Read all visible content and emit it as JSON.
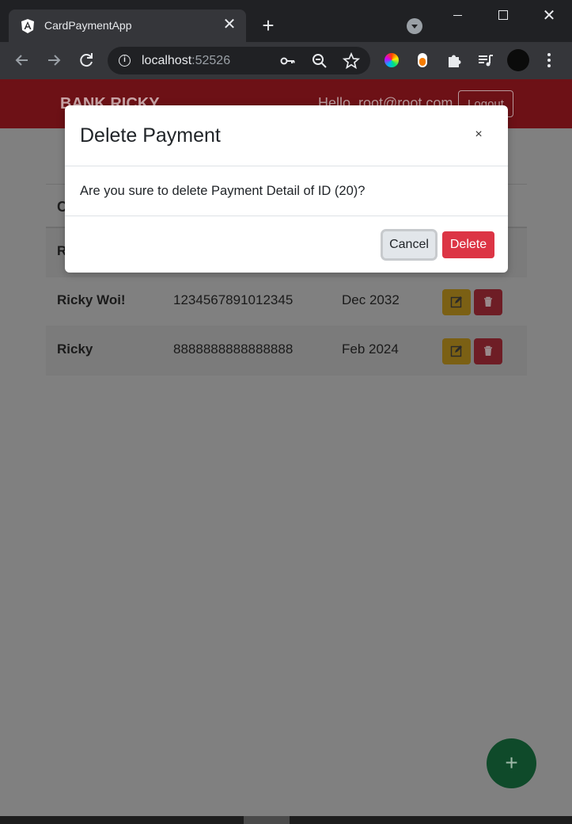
{
  "browser": {
    "tab_title": "CardPaymentApp",
    "url_host": "localhost",
    "url_port": ":52526",
    "new_tab_symbol": "+",
    "tab_close_symbol": "✕",
    "window_close_symbol": "✕"
  },
  "navbar": {
    "brand": "BANK RICKY",
    "greeting": "Hello, root@root.com",
    "logout_label": "Logout"
  },
  "table": {
    "header_owner": "C",
    "rows": [
      {
        "owner": "R",
        "number": "",
        "expiration": ""
      },
      {
        "owner": "Ricky Woi!",
        "number": "1234567891012345",
        "expiration": "Dec 2032"
      },
      {
        "owner": "Ricky",
        "number": "8888888888888888",
        "expiration": "Feb 2024"
      }
    ]
  },
  "fab": {
    "label": "+"
  },
  "modal": {
    "title": "Delete Payment",
    "close_label": "×",
    "message": "Are you sure to delete Payment Detail of ID (20)?",
    "cancel_label": "Cancel",
    "delete_label": "Delete"
  },
  "colors": {
    "navbar": "#6d1116",
    "edit_button": "#7b6014",
    "delete_button_overlay": "#6e1d25",
    "modal_delete": "#dc3545",
    "fab": "#0f4a2a",
    "overlay": "#808080"
  },
  "icons": {
    "favicon": "angular-logo-icon",
    "back": "arrow-left-icon",
    "forward": "arrow-right-icon",
    "reload": "reload-icon",
    "info": "info-icon",
    "key": "key-icon",
    "zoom": "zoom-out-icon",
    "star": "star-icon",
    "extensions": "puzzle-icon",
    "media": "media-queue-icon",
    "menu": "more-vert-icon",
    "edit": "edit-icon",
    "trash": "trash-icon"
  }
}
